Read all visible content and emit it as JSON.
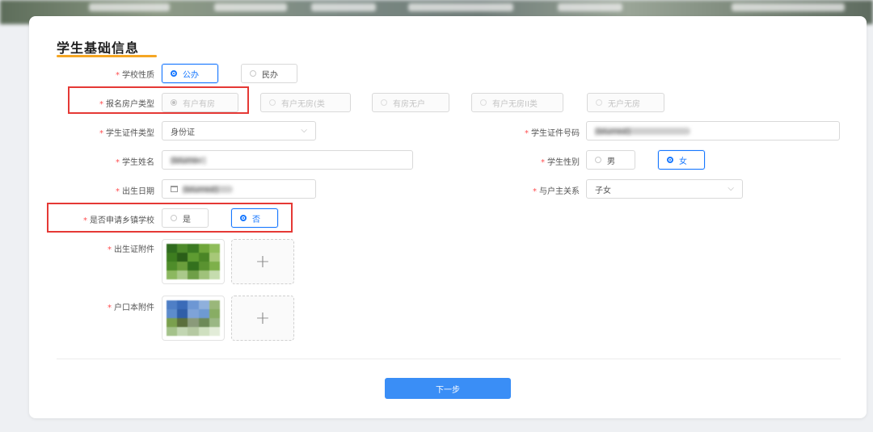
{
  "header": {
    "title": "学生基础信息"
  },
  "form": {
    "school_nature": {
      "label": "学校性质",
      "options": [
        "公办",
        "民办"
      ],
      "selected": "公办"
    },
    "household_type": {
      "label": "报名房户类型",
      "options": [
        "有户有房",
        "有户无房(类",
        "有房无户",
        "有户无房II类",
        "无户无房"
      ],
      "selected": "有户有房"
    },
    "id_type": {
      "label": "学生证件类型",
      "value": "身份证"
    },
    "id_number": {
      "label": "学生证件号码",
      "value": "[blurred]"
    },
    "student_name": {
      "label": "学生姓名",
      "value": "[blurred]"
    },
    "gender": {
      "label": "学生性别",
      "options": [
        "男",
        "女"
      ],
      "selected": "女"
    },
    "birth_date": {
      "label": "出生日期",
      "value": "[blurred]"
    },
    "relation": {
      "label": "与户主关系",
      "value": "子女"
    },
    "rural_school": {
      "label": "是否申请乡镇学校",
      "options": [
        "是",
        "否"
      ],
      "selected": "否"
    },
    "birth_cert": {
      "label": "出生证附件"
    },
    "household_book": {
      "label": "户口本附件"
    }
  },
  "actions": {
    "next_label": "下一步"
  },
  "colors": {
    "primary": "#1677ff",
    "button": "#3a8ef6",
    "required": "#ff4d4f",
    "highlight": "#e53935",
    "title_underline": "#f5a623"
  }
}
